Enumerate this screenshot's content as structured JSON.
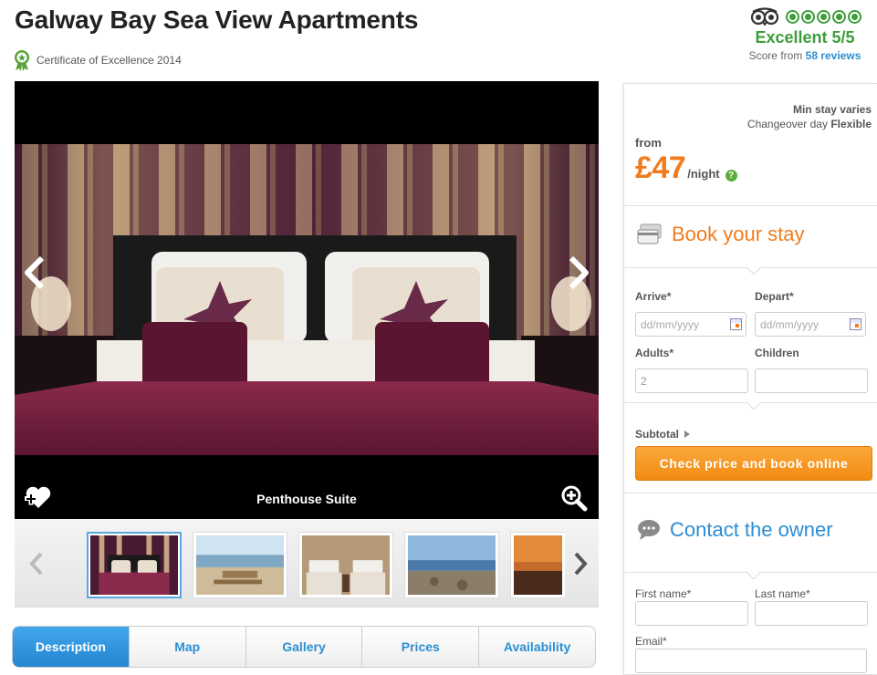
{
  "header": {
    "title": "Galway Bay Sea View Apartments",
    "certificate": "Certificate of Excellence 2014"
  },
  "rating": {
    "label": "Excellent 5/5",
    "score_prefix": "Score from",
    "reviews_link": "58 reviews",
    "bubbles": 5,
    "color": "#3d9d3a"
  },
  "gallery": {
    "caption": "Penthouse Suite",
    "thumbnails": [
      "bedroom",
      "beach-terrace",
      "twin-beds",
      "shoreline",
      "sunset"
    ],
    "active_thumbnail": 0
  },
  "tabs": [
    {
      "label": "Description",
      "active": true
    },
    {
      "label": "Map",
      "active": false
    },
    {
      "label": "Gallery",
      "active": false
    },
    {
      "label": "Prices",
      "active": false
    },
    {
      "label": "Availability",
      "active": false
    }
  ],
  "pricing": {
    "min_stay": "Min stay varies",
    "changeover_prefix": "Changeover day",
    "changeover_value": "Flexible",
    "from": "from",
    "amount": "£47",
    "per": "/night",
    "help": "?"
  },
  "booking": {
    "heading": "Book your stay",
    "arrive_label": "Arrive*",
    "depart_label": "Depart*",
    "date_placeholder": "dd/mm/yyyy",
    "adults_label": "Adults*",
    "adults_value": "2",
    "children_label": "Children",
    "children_value": "",
    "subtotal": "Subtotal",
    "cta": "Check price and book online",
    "accent": "#f07c1e"
  },
  "contact": {
    "heading": "Contact the owner",
    "first_name": "First name*",
    "last_name": "Last name*",
    "email": "Email*",
    "accent": "#2b8ed3"
  }
}
